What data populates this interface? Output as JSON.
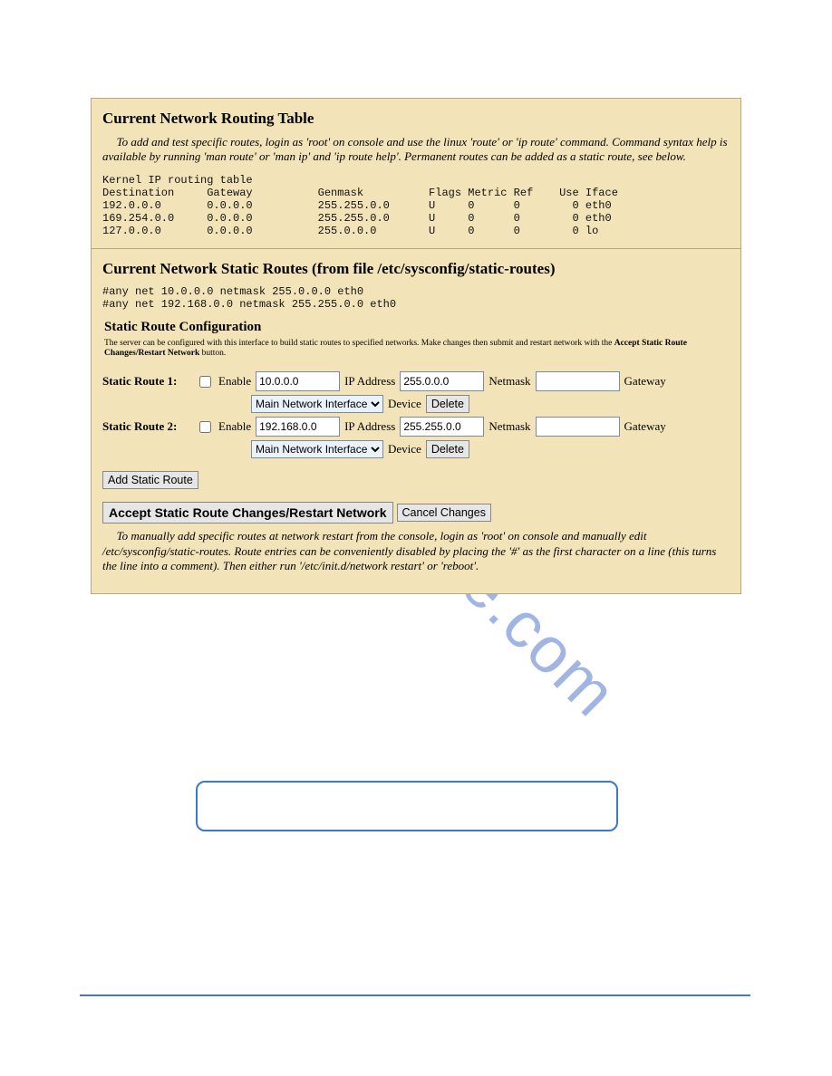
{
  "watermark": "manualshive.com",
  "routing": {
    "title": "Current Network Routing Table",
    "intro": "To add and test specific routes, login as 'root' on console and use the linux 'route' or 'ip route' command. Command syntax help is available by running 'man route' or 'man ip' and 'ip route help'. Permanent routes can be added as a static route, see below.",
    "table_text": "Kernel IP routing table\nDestination     Gateway          Genmask          Flags Metric Ref    Use Iface\n192.0.0.0       0.0.0.0          255.255.0.0      U     0      0        0 eth0\n169.254.0.0     0.0.0.0          255.255.0.0      U     0      0        0 eth0\n127.0.0.0       0.0.0.0          255.0.0.0        U     0      0        0 lo"
  },
  "static_current": {
    "title": "Current Network Static Routes   (from file /etc/sysconfig/static-routes)",
    "text": "#any net 10.0.0.0 netmask 255.0.0.0 eth0\n#any net 192.168.0.0 netmask 255.255.0.0 eth0"
  },
  "config": {
    "title": "Static Route Configuration",
    "desc_a": "The server can be configured with this interface to build static routes to specified networks. Make changes then submit and restart network with the ",
    "desc_b": "Accept Static Route Changes/Restart Network",
    "desc_c": " button.",
    "labels": {
      "enable": "Enable",
      "ip": "IP Address",
      "netmask": "Netmask",
      "gateway": "Gateway",
      "device": "Device",
      "delete": "Delete",
      "add": "Add Static Route",
      "accept": "Accept Static Route Changes/Restart Network",
      "cancel": "Cancel Changes"
    },
    "device_option": "Main Network Interface",
    "routes": [
      {
        "label": "Static Route 1:",
        "ip": "10.0.0.0",
        "mask": "255.0.0.0",
        "gw": ""
      },
      {
        "label": "Static Route 2:",
        "ip": "192.168.0.0",
        "mask": "255.255.0.0",
        "gw": ""
      }
    ],
    "footnote": "To manually add specific routes at network restart from the console, login as 'root' on console and manually edit /etc/sysconfig/static-routes. Route entries can be conveniently disabled by placing the '#' as the first character on a line (this turns the line into a comment). Then either run '/etc/init.d/network restart' or 'reboot'."
  }
}
